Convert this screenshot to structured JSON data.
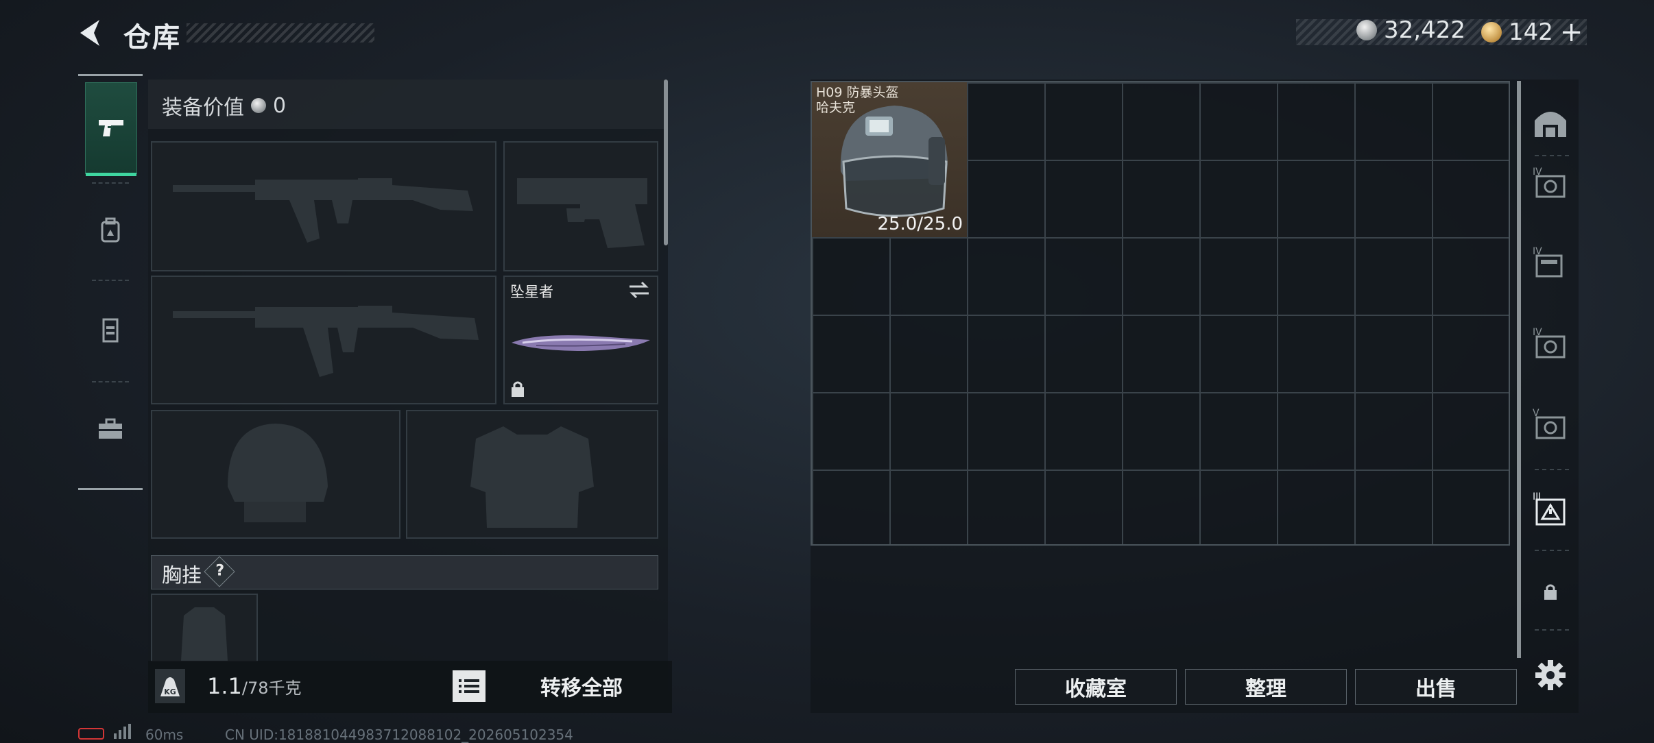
{
  "header": {
    "title": "仓库",
    "currency_primary": "32,422",
    "currency_secondary": "142",
    "plus_label": "+"
  },
  "tabs": [
    {
      "icon": "pistol-icon",
      "active": true
    },
    {
      "icon": "backpack-icon",
      "active": false
    },
    {
      "icon": "vest-icon",
      "active": false
    },
    {
      "icon": "toolbox-icon",
      "active": false
    }
  ],
  "equipment": {
    "value_label": "装备价值",
    "value": "0",
    "melee_slot_label": "坠星者",
    "chest_rig_label": "胸挂",
    "help_label": "?",
    "weight_current": "1.1",
    "weight_max": "/78千克",
    "weight_badge": "KG",
    "transfer_all_label": "转移全部"
  },
  "storage": {
    "item": {
      "name_line1": "H09 防暴头盔",
      "name_line2": "哈夫克",
      "durability": "25.0/25.0"
    },
    "buttons": {
      "collection": "收藏室",
      "organize": "整理",
      "sell": "出售"
    },
    "side_labels": [
      "IV",
      "IV",
      "IV",
      "V",
      "III"
    ]
  },
  "footer": {
    "ping": "60ms",
    "uid": "CN UID:181881044983712088102_202605102354"
  },
  "colors": {
    "accent_green": "#3fd6a0",
    "item_background": "#4a3e31",
    "battery_red": "#d33636"
  }
}
